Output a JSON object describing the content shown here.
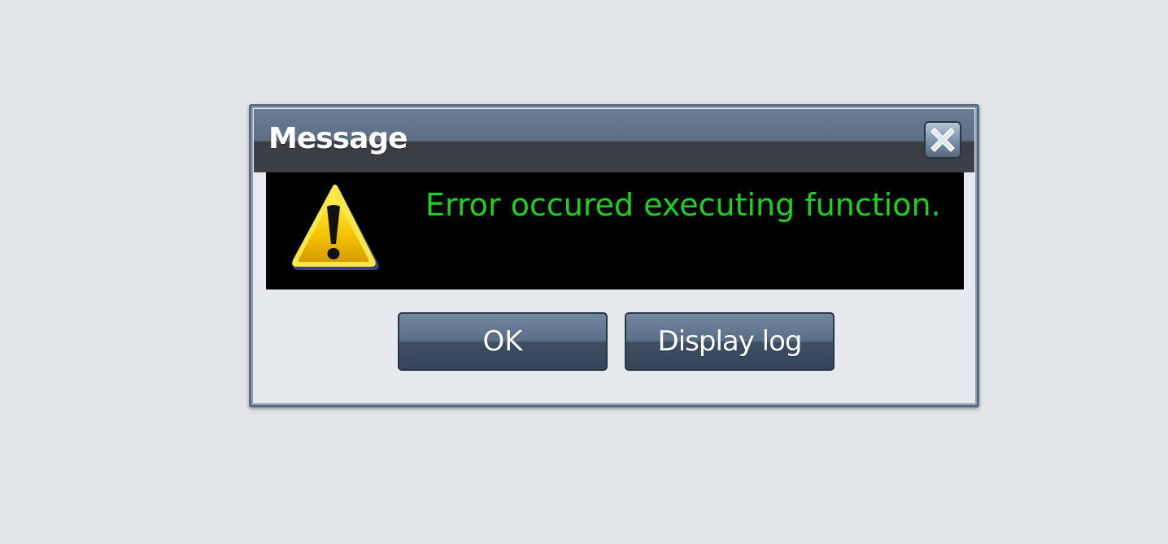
{
  "dialog": {
    "title": "Message",
    "close_icon": "close-icon",
    "warning_icon": "warning-icon",
    "message": "Error occured executing function.",
    "buttons": {
      "ok_label": "OK",
      "display_log_label": "Display log"
    }
  },
  "colors": {
    "message_text": "#1fd11f",
    "message_background": "#000000",
    "titlebar": "#5d6e84",
    "page_background": "#e1e5e9"
  }
}
